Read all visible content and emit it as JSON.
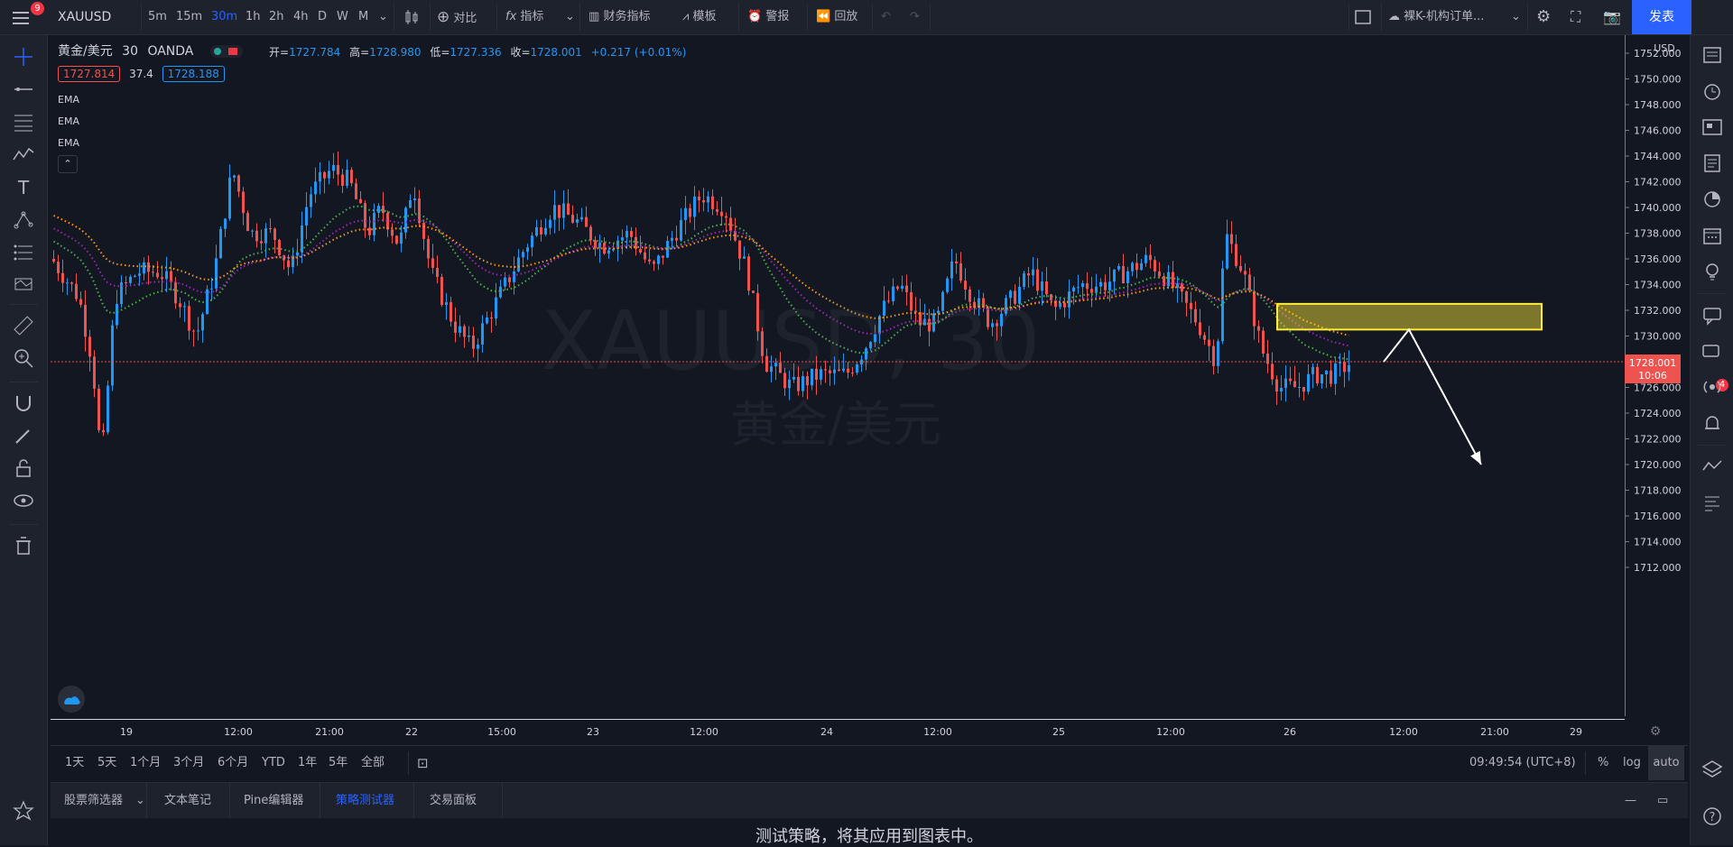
{
  "topbar": {
    "notif_count": "9",
    "symbol": "XAUUSD",
    "timeframes": [
      "5m",
      "15m",
      "30m",
      "1h",
      "2h",
      "4h",
      "D",
      "W",
      "M"
    ],
    "active_timeframe": "30m",
    "compare": "对比",
    "indicators": "指标",
    "financials": "财务指标",
    "templates": "模板",
    "alerts": "警报",
    "replay": "回放",
    "layout_name": "裸K-机构订单...",
    "publish": "发表"
  },
  "legend": {
    "title": "黄金/美元",
    "interval": "30",
    "source": "OANDA",
    "open_label": "开=",
    "open": "1727.784",
    "high_label": "高=",
    "high": "1728.980",
    "low_label": "低=",
    "low": "1727.336",
    "close_label": "收=",
    "close": "1728.001",
    "change": "+0.217 (+0.01%)",
    "bid": "1727.814",
    "spread": "37.4",
    "ask": "1728.188",
    "indicators": [
      "EMA",
      "EMA",
      "EMA"
    ]
  },
  "price_axis": {
    "currency": "USD",
    "labels": [
      "1752.000",
      "1750.000",
      "1748.000",
      "1746.000",
      "1744.000",
      "1742.000",
      "1740.000",
      "1738.000",
      "1736.000",
      "1734.000",
      "1732.000",
      "1730.000",
      "1728.000",
      "1726.000",
      "1724.000",
      "1722.000",
      "1720.000",
      "1718.000",
      "1716.000",
      "1714.000",
      "1712.000"
    ],
    "last_price": "1728.001",
    "countdown": "10:06"
  },
  "time_axis": {
    "labels": [
      "19",
      "12:00",
      "21:00",
      "22",
      "15:00",
      "23",
      "12:00",
      "24",
      "12:00",
      "25",
      "12:00",
      "26",
      "12:00",
      "21:00",
      "29"
    ]
  },
  "watermark": {
    "symbol": "XAUUSD, 30",
    "name": "黄金/美元"
  },
  "bottombar": {
    "ranges": [
      "1天",
      "5天",
      "1个月",
      "3个月",
      "6个月",
      "YTD",
      "1年",
      "5年",
      "全部"
    ],
    "clock": "09:49:54 (UTC+8)",
    "percent": "%",
    "log": "log",
    "auto": "auto"
  },
  "panel": {
    "tabs": [
      "股票筛选器",
      "文本笔记",
      "Pine编辑器",
      "策略测试器",
      "交易面板"
    ],
    "active_tab": "策略测试器",
    "message": "测试策略，将其应用到图表中。"
  },
  "rightbar": {
    "chat_badge": "4"
  },
  "colors": {
    "up": "#2196f3",
    "down": "#ef5350",
    "ema_fast": "#4caf50",
    "ema_mid": "#9c27b0",
    "ema_slow": "#ff9800",
    "accent": "#2962ff",
    "zone": "#ffeb3b"
  },
  "chart_data": {
    "type": "candlestick",
    "ylim": [
      1711,
      1753
    ],
    "annotation": {
      "zone_top": 1732.5,
      "zone_bottom": 1730.5,
      "arrow_target": 1720.0
    }
  }
}
